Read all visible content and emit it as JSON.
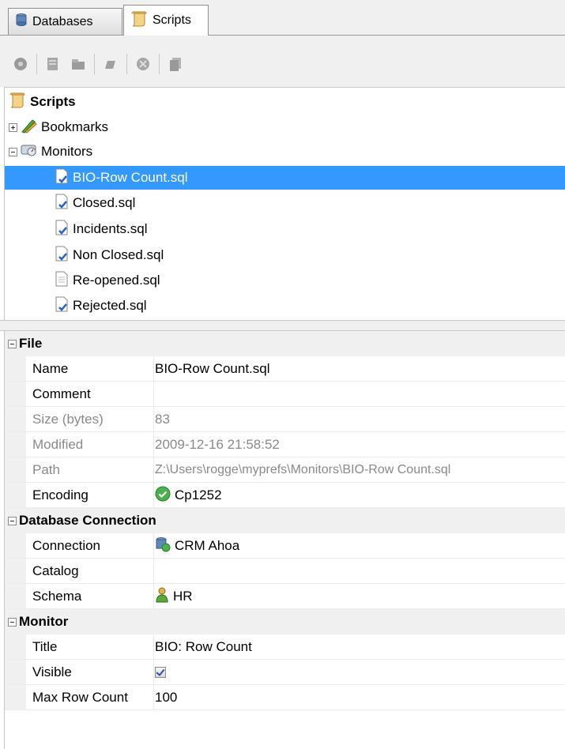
{
  "tabs": [
    {
      "label": "Databases",
      "icon": "database-icon"
    },
    {
      "label": "Scripts",
      "icon": "scroll-icon",
      "active": true
    }
  ],
  "toolbar": {
    "buttons": [
      "refresh-icon",
      "new-script-icon",
      "new-folder-icon",
      "edit-icon",
      "delete-icon",
      "copy-icon"
    ]
  },
  "tree": {
    "root": "Scripts",
    "bookmarks": "Bookmarks",
    "monitors": "Monitors",
    "files": [
      "BIO-Row Count.sql",
      "Closed.sql",
      "Incidents.sql",
      "Non Closed.sql",
      "Re-opened.sql",
      "Rejected.sql"
    ],
    "selected": "BIO-Row Count.sql"
  },
  "props": {
    "file": {
      "title": "File",
      "name_label": "Name",
      "name_value": "BIO-Row Count.sql",
      "comment_label": "Comment",
      "comment_value": "",
      "size_label": "Size (bytes)",
      "size_value": "83",
      "modified_label": "Modified",
      "modified_value": "2009-12-16 21:58:52",
      "path_label": "Path",
      "path_value": "Z:\\Users\\rogge\\myprefs\\Monitors\\BIO-Row Count.sql",
      "encoding_label": "Encoding",
      "encoding_value": "Cp1252"
    },
    "db": {
      "title": "Database Connection",
      "connection_label": "Connection",
      "connection_value": "CRM Ahoa",
      "catalog_label": "Catalog",
      "catalog_value": "",
      "schema_label": "Schema",
      "schema_value": "HR"
    },
    "monitor": {
      "title": "Monitor",
      "title_label": "Title",
      "title_value": "BIO: Row Count",
      "visible_label": "Visible",
      "visible_value": true,
      "maxrow_label": "Max Row Count",
      "maxrow_value": "100"
    }
  },
  "colors": {
    "selection": "#3399ff",
    "panel": "#f0f0f0",
    "readonly_text": "#8a8a8a"
  }
}
